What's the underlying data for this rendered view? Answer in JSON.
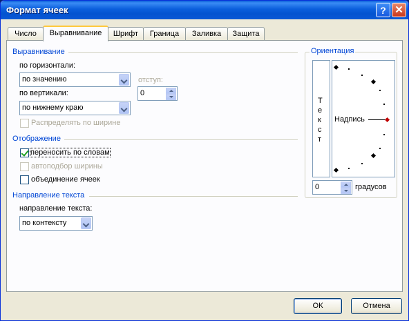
{
  "window": {
    "title": "Формат ячеек"
  },
  "tabs": [
    "Число",
    "Выравнивание",
    "Шрифт",
    "Граница",
    "Заливка",
    "Защита"
  ],
  "alignment": {
    "group_title": "Выравнивание",
    "horizontal_label": "по горизонтали:",
    "horizontal_value": "по значению",
    "indent_label": "отступ:",
    "indent_value": "0",
    "vertical_label": "по вертикали:",
    "vertical_value": "по нижнему краю",
    "distribute_label": "Распределять по ширине"
  },
  "display": {
    "group_title": "Отображение",
    "wrap_label": "переносить по словам",
    "wrap_checked": true,
    "shrink_label": "автоподбор ширины",
    "merge_label": "объединение ячеек"
  },
  "text_direction": {
    "group_title": "Направление текста",
    "label": "направление текста:",
    "value": "по контексту"
  },
  "orientation": {
    "group_title": "Ориентация",
    "vertical_text": [
      "Т",
      "е",
      "к",
      "с",
      "т"
    ],
    "dial_label": "Надпись",
    "degrees_value": "0",
    "degrees_label": "градусов",
    "indicator_color": "#c00000"
  },
  "buttons": {
    "ok": "ОК",
    "cancel": "Отмена"
  }
}
